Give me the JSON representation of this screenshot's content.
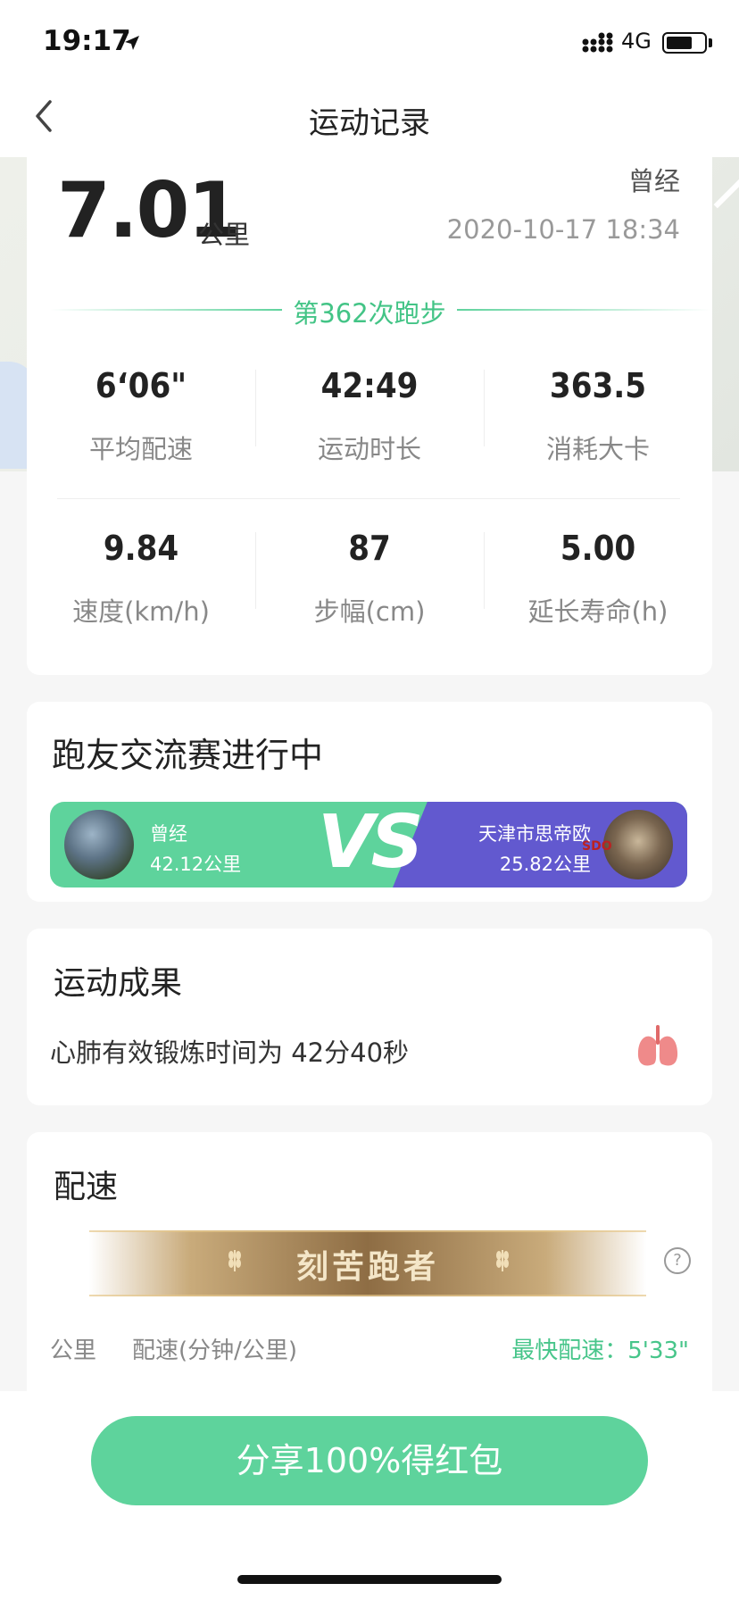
{
  "status_bar": {
    "time": "19:17",
    "network": "4G",
    "icons": [
      "location-arrow-icon",
      "signal-icon",
      "battery-icon"
    ]
  },
  "nav": {
    "title": "运动记录",
    "back_icon": "chevron-left-icon"
  },
  "summary": {
    "distance": "7.01",
    "distance_unit": "公里",
    "user_name": "曾经",
    "datetime": "2020-10-17 18:34",
    "run_count": "第362次跑步"
  },
  "stats": [
    {
      "value": "6‘06\"",
      "label": "平均配速"
    },
    {
      "value": "42:49",
      "label": "运动时长"
    },
    {
      "value": "363.5",
      "label": "消耗大卡"
    },
    {
      "value": "9.84",
      "label": "速度(km/h)"
    },
    {
      "value": "87",
      "label": "步幅(cm)"
    },
    {
      "value": "5.00",
      "label": "延长寿命(h)"
    }
  ],
  "race": {
    "title": "跑友交流赛进行中",
    "vs_text": "VS",
    "left": {
      "name": "曾经",
      "distance": "42.12公里"
    },
    "right": {
      "name": "天津市思帝欧",
      "distance": "25.82公里",
      "logo_text": "SDO"
    }
  },
  "result": {
    "title": "运动成果",
    "text": "心肺有效锻炼时间为 42分40秒",
    "icon": "lungs-icon"
  },
  "pace": {
    "title": "配速",
    "badge": "刻苦跑者",
    "help_icon": "?",
    "col_km": "公里",
    "col_pace": "配速(分钟/公里)",
    "fastest": "最快配速：5'33\""
  },
  "share_button": "分享100%得红包",
  "colors": {
    "accent_green": "#5ed39c",
    "text_green": "#43c486",
    "purple": "#6259cf",
    "gold": "#8e6d44"
  }
}
